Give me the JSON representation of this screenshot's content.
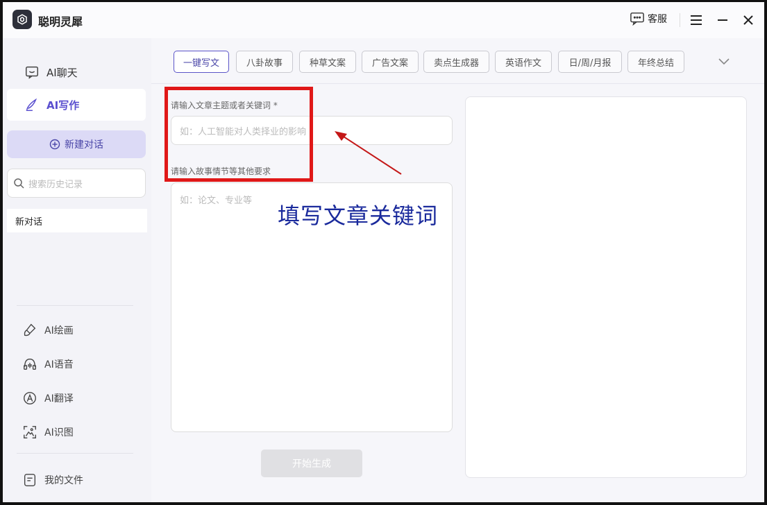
{
  "app": {
    "title": "聪明灵犀",
    "kefu_label": "客服"
  },
  "sidebar": {
    "nav": [
      {
        "label": "AI聊天",
        "icon": "chat-icon"
      },
      {
        "label": "AI写作",
        "icon": "pen-icon"
      }
    ],
    "new_chat_label": "新建对话",
    "search_placeholder": "搜索历史记录",
    "history": [
      "新对话"
    ],
    "tools": [
      {
        "label": "AI绘画",
        "icon": "brush-icon"
      },
      {
        "label": "AI语音",
        "icon": "voice-icon"
      },
      {
        "label": "AI翻译",
        "icon": "translate-icon"
      },
      {
        "label": "AI识图",
        "icon": "image-recognize-icon"
      }
    ],
    "my_files_label": "我的文件"
  },
  "tabs": [
    "一键写文",
    "八卦故事",
    "种草文案",
    "广告文案",
    "卖点生成器",
    "英语作文",
    "日/周/月报",
    "年终总结"
  ],
  "form": {
    "keyword_label": "请输入文章主题或者关键词 *",
    "keyword_placeholder": "如：人工智能对人类择业的影响",
    "detail_label": "请输入故事情节等其他要求",
    "detail_placeholder": "如：论文、专业等",
    "generate_label": "开始生成"
  },
  "annotation": {
    "text": "填写文章关键词"
  },
  "colors": {
    "accent": "#5a4fcf",
    "annotation_box": "#e01818",
    "annotation_text": "#1a2a9c"
  }
}
